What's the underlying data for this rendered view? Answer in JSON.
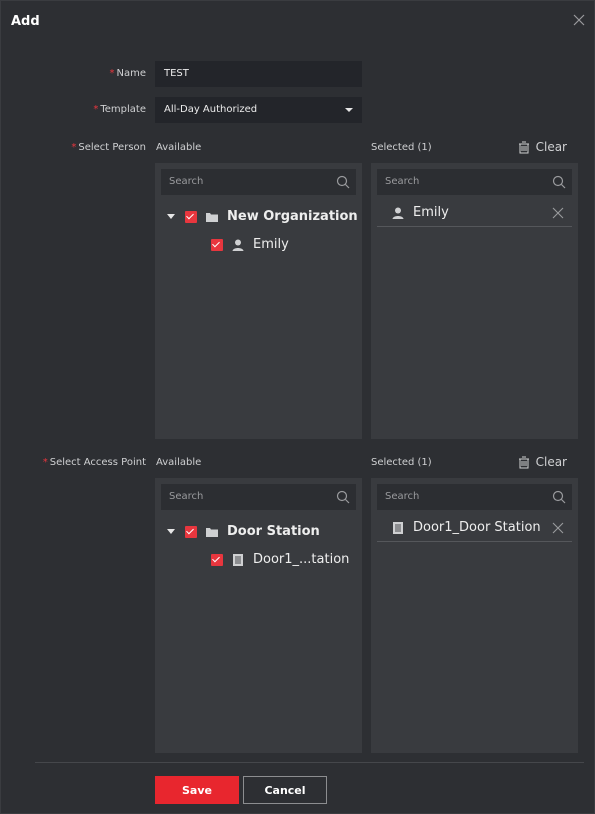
{
  "dialog": {
    "title": "Add"
  },
  "form": {
    "name_label": "Name",
    "name_value": "TEST",
    "template_label": "Template",
    "template_value": "All-Day Authorized",
    "select_person_label": "Select Person",
    "select_access_label": "Select Access Point"
  },
  "person": {
    "available_label": "Available",
    "selected_label": "Selected  (1)",
    "clear_label": "Clear",
    "search_placeholder": "Search",
    "search_placeholder_right": "Search",
    "tree_root": "New Organization",
    "tree_child": "Emily",
    "selected_item": "Emily"
  },
  "access": {
    "available_label": "Available",
    "selected_label": "Selected  (1)",
    "clear_label": "Clear",
    "search_placeholder": "Search",
    "search_placeholder_right": "Search",
    "tree_root": "Door Station",
    "tree_child": "Door1_...tation",
    "selected_item": "Door1_Door Station"
  },
  "footer": {
    "save_label": "Save",
    "cancel_label": "Cancel"
  },
  "colors": {
    "accent": "#e8262e",
    "panel": "#393b3f",
    "background": "#2d2f33"
  }
}
